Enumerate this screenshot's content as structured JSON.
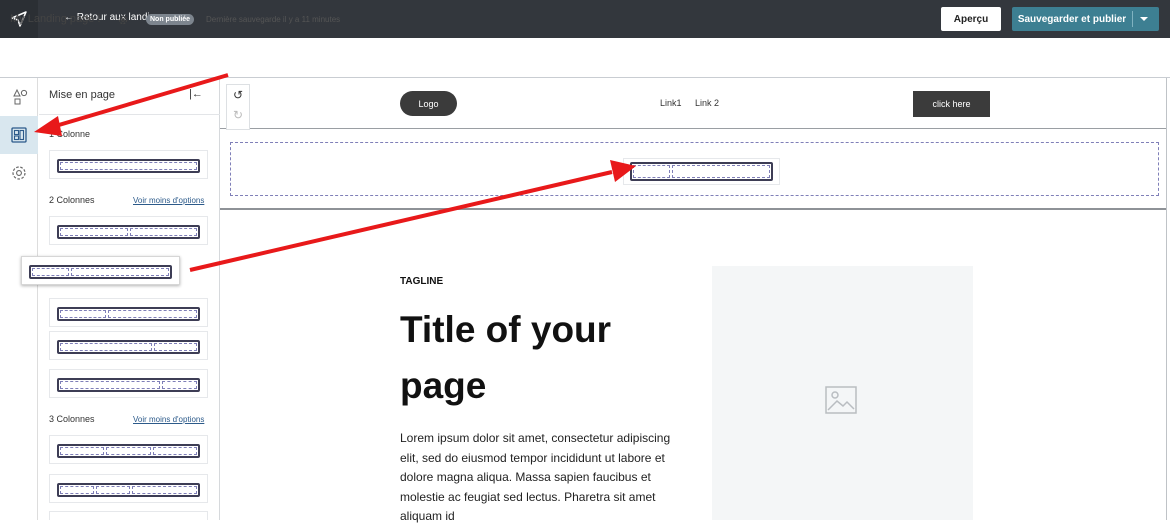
{
  "topbar": {
    "back_label": "← Retour aux landing pages",
    "preview_label": "Aperçu",
    "publish_label": "Sauvegarder et publier"
  },
  "subheader": {
    "page_name": "My Landing page !",
    "status_badge": "Non publiée",
    "saved_text": "Dernière sauvegarde il y a 11 minutes"
  },
  "panel": {
    "title": "Mise en page",
    "sections": [
      {
        "label": "1 Colonne"
      },
      {
        "label": "2 Colonnes",
        "more_label": "Voir moins d'options"
      },
      {
        "label": "3 Colonnes",
        "more_label": "Voir moins d'options"
      }
    ]
  },
  "canvas": {
    "header": {
      "logo": "Logo",
      "links": [
        "Link1",
        "Link 2"
      ],
      "cta": "click here"
    },
    "hero": {
      "tagline": "TAGLINE",
      "title": "Title of your page",
      "body": "Lorem ipsum dolor sit amet, consectetur adipiscing elit, sed do eiusmod tempor incididunt ut labore et dolore magna aliqua. Massa sapien faucibus et molestie ac feugiat sed lectus. Pharetra sit amet aliquam id"
    }
  },
  "colors": {
    "topbar": "#33373d",
    "publish_button": "#3d7f92",
    "annotation_arrow": "#e8191a",
    "dashed_outline": "#7f7fb8"
  }
}
